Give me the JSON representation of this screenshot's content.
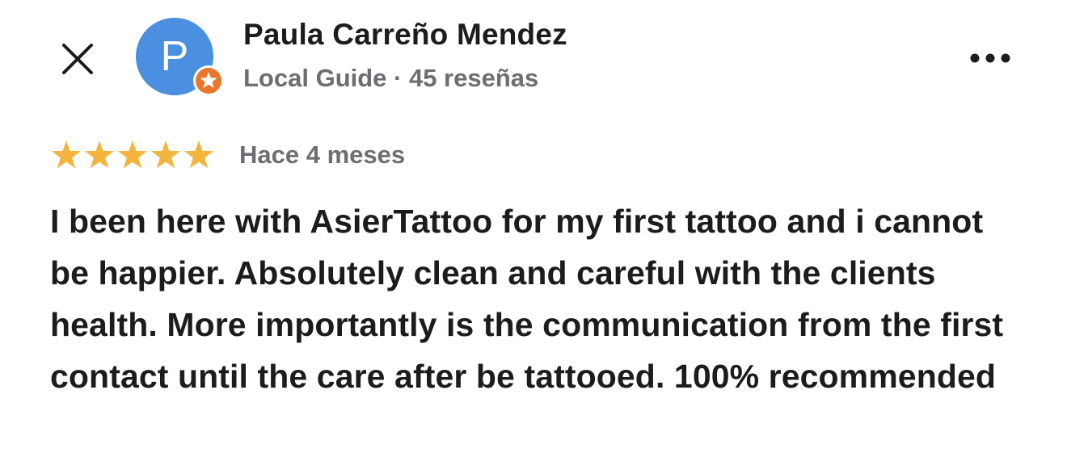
{
  "review": {
    "author": {
      "name": "Paula Carreño Mendez",
      "initial": "P",
      "meta": "Local Guide · 45 reseñas",
      "avatar_color": "#4a8fe0",
      "badge_color": "#e8762d"
    },
    "rating": 5,
    "max_rating": 5,
    "star_color": "#f4b53f",
    "date": "Hace 4 meses",
    "text": "I been here with AsierTattoo for my first tattoo and i cannot be happier. Absolutely clean and careful with the clients health. More importantly is the communication from the first contact until the care after be tattooed. 100% recommended"
  },
  "icons": {
    "close": "close-icon",
    "more": "more-horizontal-icon",
    "badge": "local-guide-star-icon",
    "star": "star-icon"
  }
}
